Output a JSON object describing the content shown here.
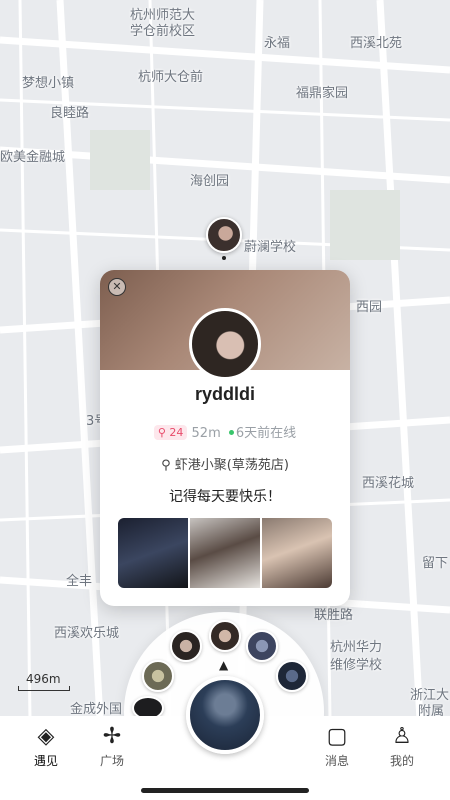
{
  "map": {
    "labels": [
      "杭州师范大",
      "学仓前校区",
      "永福",
      "西溪北苑",
      "梦想小镇",
      "杭师大仓前",
      "良睦路",
      "福鼎家园",
      "欧美金融城",
      "海创园",
      "蔚澜学校",
      "西园",
      "3号",
      "西溪花城",
      "全丰",
      "留下",
      "西溪欢乐城",
      "联胜路",
      "杭州华力",
      "维修学校",
      "浙江大",
      "附属",
      "金成外国"
    ],
    "scale": "496m"
  },
  "card": {
    "close_icon": "close-icon",
    "username": "ryddldi",
    "badge_count": "24",
    "distance": "52m",
    "online_status": "6天前在线",
    "location": "虾港小聚(草荡苑店)",
    "bio": "记得每天要快乐！"
  },
  "tabs": [
    {
      "label": "遇见",
      "icon": "compass-icon",
      "active": true
    },
    {
      "label": "广场",
      "icon": "pinwheel-icon",
      "active": false
    },
    {
      "label": "消息",
      "icon": "chat-icon",
      "active": false
    },
    {
      "label": "我的",
      "icon": "person-icon",
      "active": false
    }
  ]
}
